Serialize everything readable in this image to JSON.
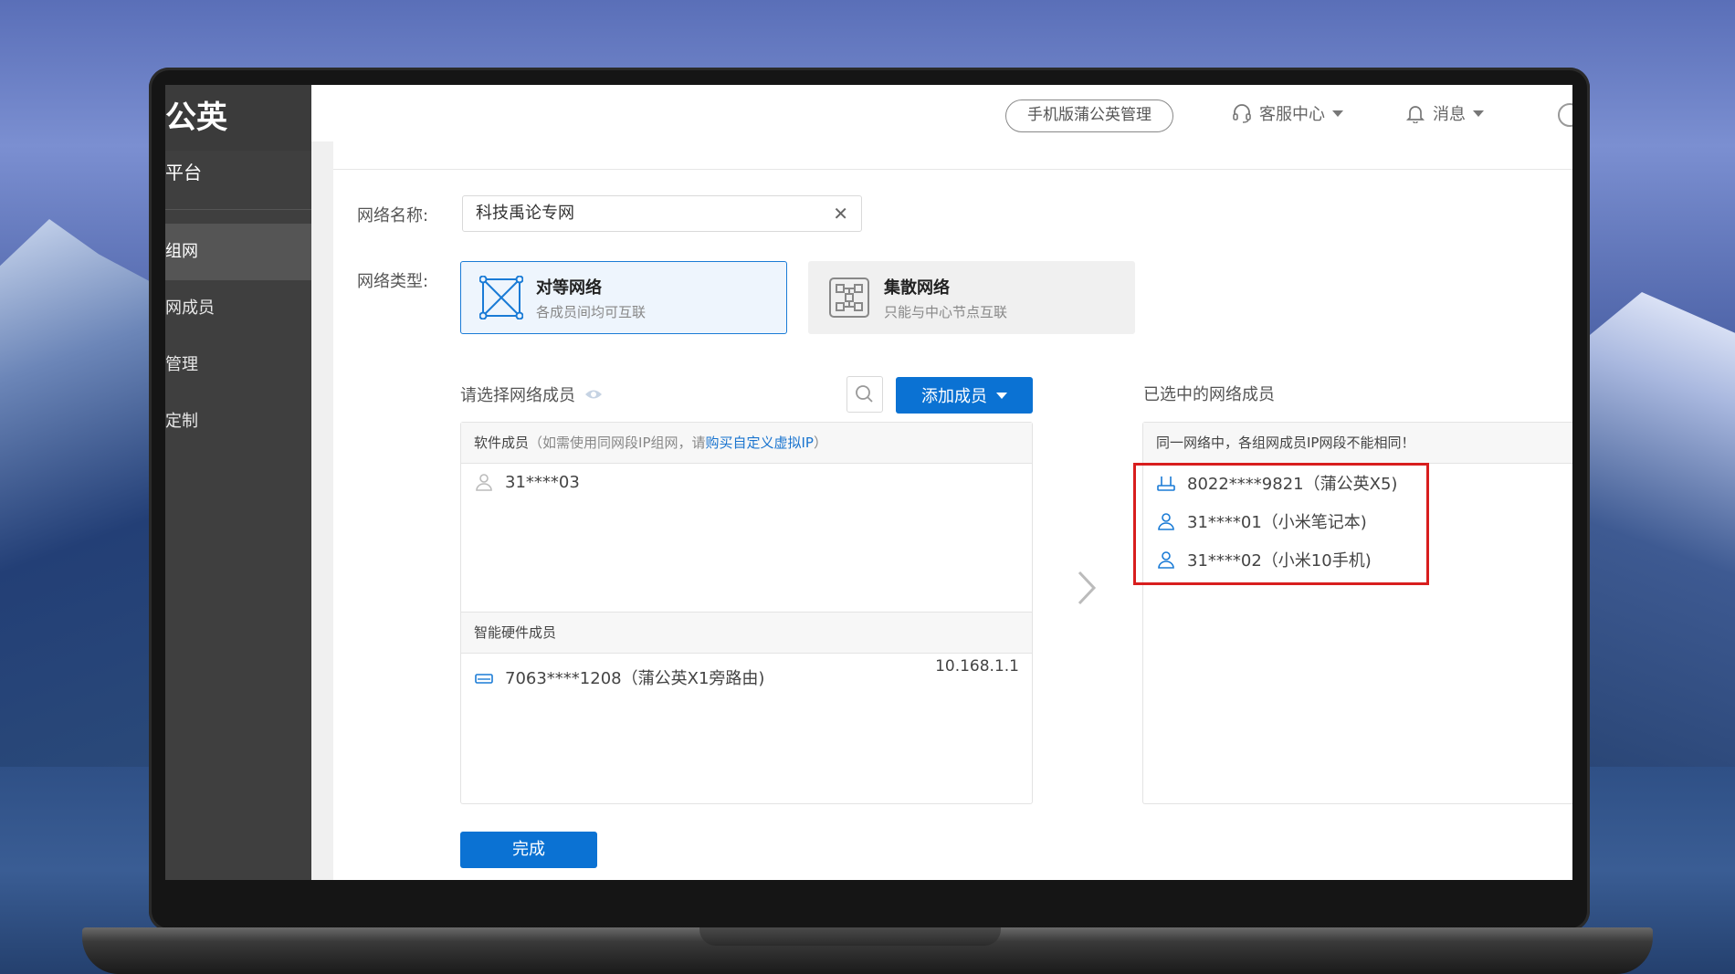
{
  "sidebar": {
    "brand": "公英",
    "platform": "平台",
    "items": [
      {
        "label": "组网",
        "active": true
      },
      {
        "label": "网成员",
        "active": false
      },
      {
        "label": "管理",
        "active": false
      },
      {
        "label": "定制",
        "active": false
      }
    ]
  },
  "topbar": {
    "mobile_button": "手机版蒲公英管理",
    "service": "客服中心",
    "messages": "消息"
  },
  "form": {
    "name_label": "网络名称:",
    "name_value": "科技禹论专网",
    "type_label": "网络类型:",
    "types": [
      {
        "title": "对等网络",
        "desc": "各成员间均可互联",
        "selected": true
      },
      {
        "title": "集散网络",
        "desc": "只能与中心节点互联",
        "selected": false
      }
    ]
  },
  "members": {
    "select_title": "请选择网络成员",
    "add_button": "添加成员",
    "software_header": "软件成员",
    "software_note_prefix": "（如需使用同网段IP组网，请",
    "software_note_link": "购买自定义虚拟IP",
    "software_note_suffix": "）",
    "software_items": [
      {
        "name": "31****03"
      }
    ],
    "hardware_header": "智能硬件成员",
    "hardware_items": [
      {
        "name": "7063****1208（蒲公英X1旁路由)",
        "ip": "10.168.1.1"
      }
    ],
    "selected_title": "已选中的网络成员",
    "selected_note": "同一网络中，各组网成员IP网段不能相同！",
    "selected_items": [
      {
        "name": "8022****9821（蒲公英X5)",
        "kind": "router-icon"
      },
      {
        "name": "31****01（小米笔记本)",
        "kind": "user-icon"
      },
      {
        "name": "31****02（小米10手机)",
        "kind": "user-icon"
      }
    ]
  },
  "done_button": "完成",
  "colors": {
    "primary": "#0b72d3",
    "highlight": "#d81e1e",
    "sidebar": "#3f3f3f"
  }
}
